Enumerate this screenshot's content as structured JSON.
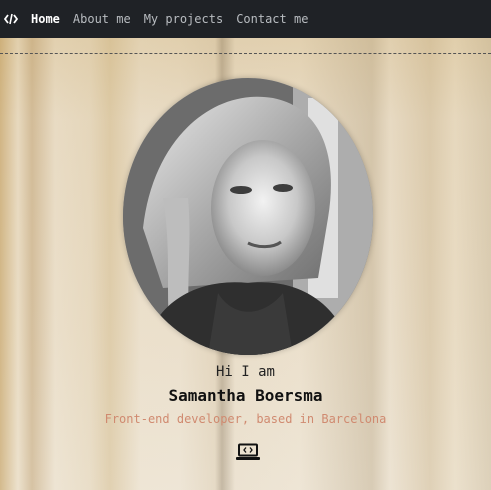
{
  "nav": {
    "logo_icon": "code-icon",
    "links": [
      {
        "label": "Home",
        "active": true
      },
      {
        "label": "About me",
        "active": false
      },
      {
        "label": "My projects",
        "active": false
      },
      {
        "label": "Contact me",
        "active": false
      }
    ]
  },
  "hero": {
    "greeting": "Hi I am",
    "name": "Samantha Boersma",
    "tagline": "Front-end developer, based in Barcelona",
    "icon": "laptop-code-icon"
  },
  "colors": {
    "nav_bg": "#1f2226",
    "tagline": "#d08a70",
    "background": "#e9ddc8"
  }
}
